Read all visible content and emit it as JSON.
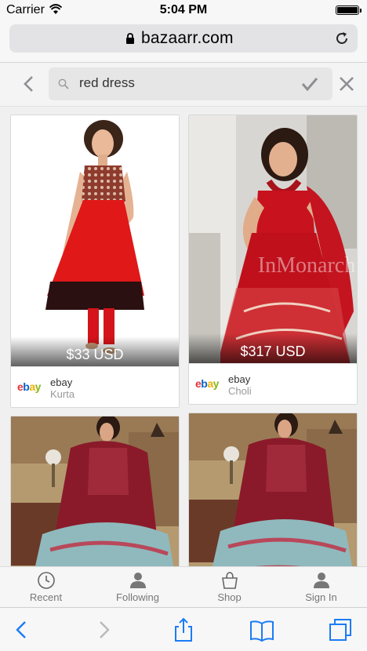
{
  "status_bar": {
    "carrier": "Carrier",
    "time": "5:04 PM"
  },
  "browser": {
    "url": "bazaarr.com"
  },
  "search": {
    "query": "red dress"
  },
  "products": [
    {
      "price": "$33 USD",
      "source": "ebay",
      "store": "ebay",
      "category": "Kurta"
    },
    {
      "price": "$317 USD",
      "source": "ebay",
      "store": "ebay",
      "category": "Choli"
    },
    {
      "price": "",
      "source": "",
      "store": "",
      "category": ""
    },
    {
      "price": "",
      "source": "",
      "store": "",
      "category": ""
    }
  ],
  "watermark": "InMonarch",
  "app_tabs": [
    {
      "label": "Recent",
      "icon": "clock-icon"
    },
    {
      "label": "Following",
      "icon": "person-icon"
    },
    {
      "label": "Shop",
      "icon": "shopping-bag-icon"
    },
    {
      "label": "Sign In",
      "icon": "person-icon"
    }
  ],
  "safari_toolbar": [
    "back-icon",
    "forward-icon",
    "share-icon",
    "bookmarks-icon",
    "tabs-icon"
  ],
  "colors": {
    "accent": "#1a7cf5",
    "ebay_red": "#e53238",
    "ebay_blue": "#0064d2",
    "ebay_yellow": "#f5af02",
    "ebay_green": "#86b817"
  }
}
